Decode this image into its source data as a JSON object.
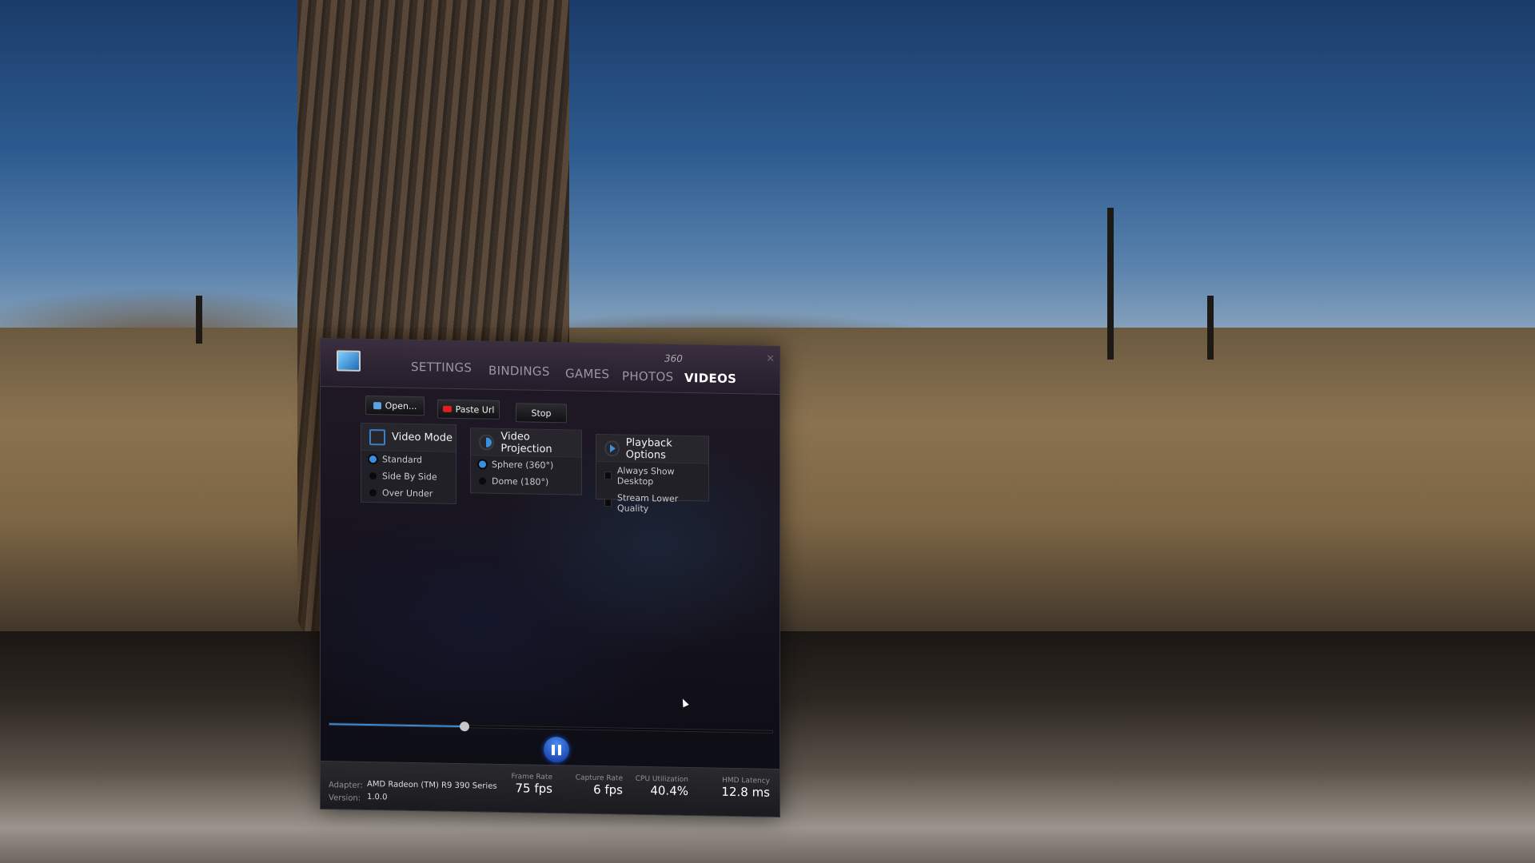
{
  "header": {
    "tabs": [
      {
        "label": "SETTINGS",
        "active": false
      },
      {
        "label": "BINDINGS",
        "active": false
      },
      {
        "label": "GAMES",
        "active": false
      },
      {
        "label": "PHOTOS",
        "active": false
      },
      {
        "label": "VIDEOS",
        "active": true
      }
    ],
    "tab_superscript": "360"
  },
  "toolbar": {
    "open_label": "Open...",
    "paste_url_label": "Paste Url",
    "stop_label": "Stop"
  },
  "video_mode": {
    "title": "Video Mode",
    "options": [
      "Standard",
      "Side By Side",
      "Over Under"
    ],
    "selected": "Standard"
  },
  "video_projection": {
    "title": "Video Projection",
    "options": [
      "Sphere (360°)",
      "Dome (180°)"
    ],
    "selected": "Sphere (360°)"
  },
  "playback_options": {
    "title": "Playback Options",
    "options": [
      {
        "label": "Always Show Desktop",
        "checked": false
      },
      {
        "label": "Stream Lower Quality",
        "checked": false
      }
    ]
  },
  "player": {
    "progress_percent": 30.5,
    "state": "playing",
    "accent": "#3a8ad8"
  },
  "footer": {
    "adapter_label": "Adapter:",
    "adapter_value": "AMD Radeon (TM) R9 390 Series",
    "version_label": "Version:",
    "version_value": "1.0.0",
    "stats": [
      {
        "label": "Frame Rate",
        "value": "75 fps"
      },
      {
        "label": "Capture Rate",
        "value": "6 fps"
      },
      {
        "label": "CPU Utilization",
        "value": "40.4%"
      },
      {
        "label": "HMD Latency",
        "value": "12.8 ms"
      }
    ]
  }
}
